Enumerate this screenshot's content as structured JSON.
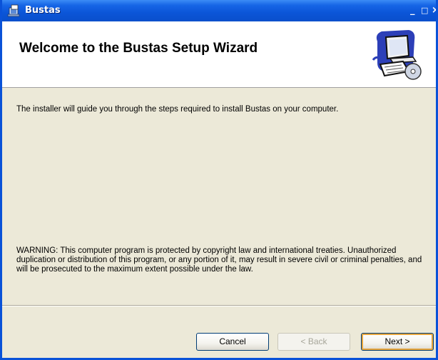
{
  "window": {
    "title": "Bustas",
    "minimize_glyph": "_",
    "maximize_glyph": "□",
    "close_glyph": "×"
  },
  "banner": {
    "heading": "Welcome to the Bustas Setup Wizard",
    "art_icon": "computer-with-cd-icon"
  },
  "content": {
    "intro": "The installer will guide you through the steps required to install Bustas on your computer.",
    "warning": "WARNING: This computer program is protected by copyright law and international treaties. Unauthorized duplication or distribution of this program, or any portion of it, may result in severe civil or criminal penalties, and will be prosecuted to the maximum extent possible under the law."
  },
  "buttons": {
    "cancel": "Cancel",
    "back": "< Back",
    "next": "Next >"
  },
  "colors": {
    "titlebar": "#0a52d8",
    "dialog_bg": "#ece9d8",
    "default_button_highlight": "#e7a53c"
  }
}
